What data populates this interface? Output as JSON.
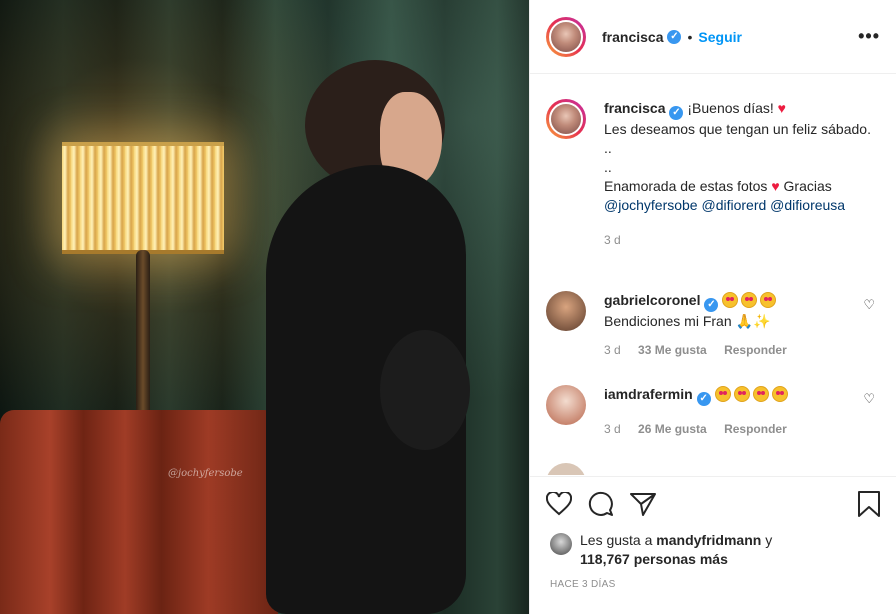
{
  "post": {
    "username": "francisca",
    "follow_label": "Seguir",
    "separator": "•",
    "more_label": "•••",
    "watermark": "@jochyfersobe"
  },
  "caption": {
    "username": "francisca",
    "line1": "¡Buenos días!",
    "line2": "Les deseamos que tengan un feliz sábado.",
    "dots1": "..",
    "dots2": "..",
    "line3": "Enamorada de estas fotos",
    "line3_end": "Gracias",
    "mentions": [
      "@jochyfersobe",
      "@difiorerd",
      "@difioreusa"
    ],
    "time": "3 d"
  },
  "comments": [
    {
      "username": "gabrielcoronel",
      "text": "Bendiciones mi Fran",
      "time": "3 d",
      "likes": "33 Me gusta",
      "reply": "Responder",
      "emoji_count": 3,
      "avatar_color": "#8a5a3c"
    },
    {
      "username": "iamdrafermin",
      "text": "",
      "time": "3 d",
      "likes": "26 Me gusta",
      "reply": "Responder",
      "emoji_count": 4,
      "avatar_color": "#c98a6a"
    }
  ],
  "likes": {
    "prefix": "Les gusta a",
    "user": "mandyfridmann",
    "conj": "y",
    "count": "118,767 personas más"
  },
  "posted": "HACE 3 DÍAS",
  "icons": [
    "heart-icon",
    "comment-icon",
    "share-icon",
    "bookmark-icon",
    "verified-icon"
  ]
}
